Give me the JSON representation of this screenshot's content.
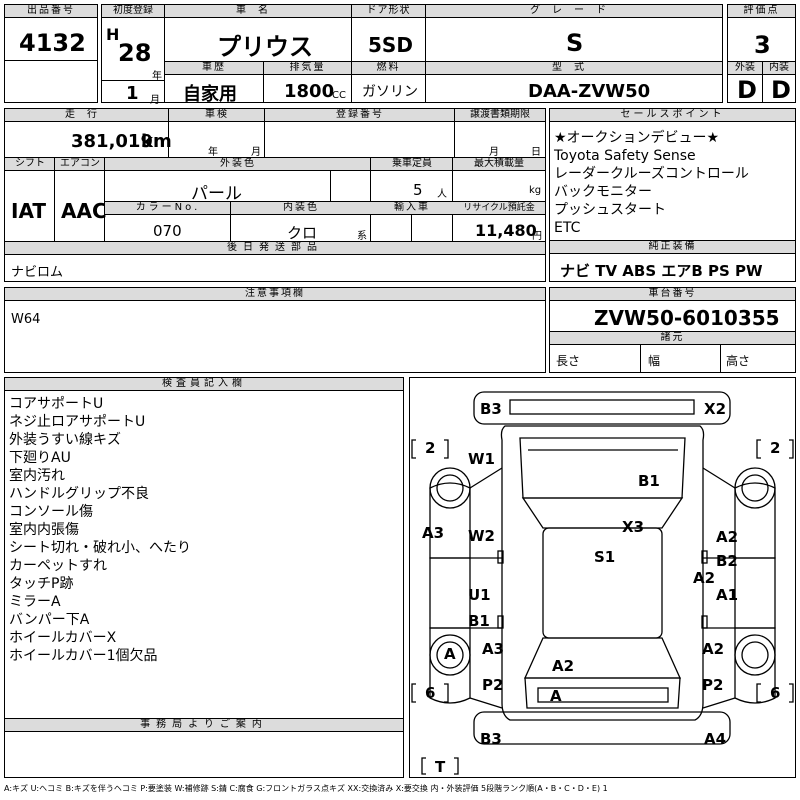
{
  "labels": {
    "lot_no": "出品番号",
    "first_reg": "初度登録",
    "car_name": "車名",
    "door": "ドア形状",
    "grade": "グレード",
    "score": "評価点",
    "history": "車歴",
    "displacement": "排気量",
    "fuel": "燃料",
    "model": "型式",
    "exterior": "外装",
    "interior": "内装",
    "mileage": "走行",
    "inspection": "車検",
    "reg_no": "登録番号",
    "transfer": "譲渡書類期限",
    "sales_points": "セールスポイント",
    "shift": "シフト",
    "ac": "エアコン",
    "ext_color": "外装色",
    "capacity": "乗車定員",
    "max_load": "最大積載量",
    "color_no": "カラーNo.",
    "int_color": "内装色",
    "import": "輸入車",
    "recycle": "リサイクル預託金",
    "later_parts": "後日発送部品",
    "genuine": "純正装備",
    "caution": "注意事項欄",
    "chassis": "車台番号",
    "specs": "諸元",
    "length": "長さ",
    "width": "幅",
    "height": "高さ",
    "inspector": "検査員記入欄",
    "office": "事務局よりご案内"
  },
  "units": {
    "year": "年",
    "month": "月",
    "cc": "CC",
    "km": "km",
    "person": "人",
    "kg": "kg",
    "yen": "円",
    "kei": "系"
  },
  "values": {
    "lot_no": "4132",
    "era": "H",
    "year": "28",
    "month": "1",
    "car_name": "プリウス",
    "door": "5SD",
    "grade": "S",
    "score": "3",
    "history": "自家用",
    "displacement": "1800",
    "fuel": "ガソリン",
    "model": "DAA-ZVW50",
    "exterior": "D",
    "interior": "D",
    "mileage": "381,019",
    "shift": "IAT",
    "ac": "AAC",
    "ext_color": "パール",
    "capacity": "5",
    "color_no": "070",
    "int_color": "クロ",
    "recycle": "11,480",
    "later_parts": "ナビロム",
    "genuine": "ナビ TV ABS エアB PS PW",
    "caution": "W64",
    "chassis": "ZVW50-6010355"
  },
  "sales_points": [
    "★オークションデビュー★",
    "Toyota Safety Sense",
    "レーダークルーズコントロール",
    "バックモニター",
    "プッシュスタート",
    "ETC"
  ],
  "inspector_notes": [
    "コアサポートU",
    "ネジ止ロアサポートU",
    "外装うすい線キズ",
    "下廻りAU",
    "室内汚れ",
    "ハンドルグリップ不良",
    "コンソール傷",
    "室内内張傷",
    "シート切れ・破れ小、へたり",
    "カーペットすれ",
    "タッチP跡",
    "ミラーA",
    "バンパー下A",
    "ホイールカバーX",
    "ホイールカバー1個欠品"
  ],
  "diagram": {
    "marks": {
      "b3_top": "B3",
      "x2": "X2",
      "w1": "W1",
      "b1_roof": "B1",
      "a3_left": "A3",
      "w2": "W2",
      "x3": "X3",
      "s1": "S1",
      "a2_rf": "A2",
      "b2": "B2",
      "a2_rm": "A2",
      "u1": "U1",
      "a1": "A1",
      "b1_lr": "B1",
      "a_wheel": "A",
      "a3_lr": "A3",
      "a2_rr": "A2",
      "a2_rear": "A2",
      "p2_left": "P2",
      "p2_right": "P2",
      "a_rear": "A",
      "b3_bottom": "B3",
      "a4": "A4",
      "t": "T",
      "tire_lf": "2",
      "tire_rf": "2",
      "tire_lr": "6",
      "tire_rr": "6"
    }
  },
  "legend": "A:キズ U:ヘコミ B:キズを伴うヘコミ P:要塗装 W:補修跡 S:錆 C:腐食 G:フロントガラス点キズ XX:交換済み X:要交換 内・外装評価 5段階ランク順(A・B・C・D・E) 1"
}
